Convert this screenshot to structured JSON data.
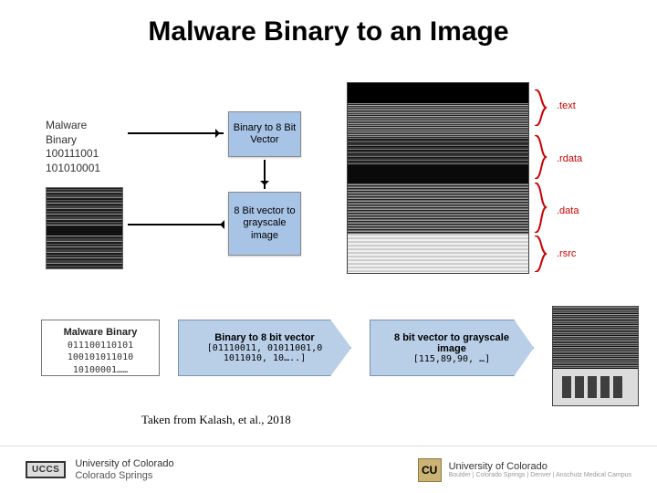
{
  "title": "Malware Binary to an Image",
  "upper": {
    "malware_label_l1": "Malware",
    "malware_label_l2": "Binary",
    "malware_bits_l1": "100111001",
    "malware_bits_l2": "101010001",
    "box_binary": "Binary to 8 Bit Vector",
    "box_vector": "8 Bit vector to grayscale image",
    "sections": {
      "text": ".text",
      "rdata": ".rdata",
      "data": ".data",
      "rsrc": ".rsrc"
    }
  },
  "lower": {
    "box1_hdr": "Malware Binary",
    "box1_l1": "011100110101",
    "box1_l2": "100101011010",
    "box1_l3": "10100001……",
    "arrow1_hdr": "Binary to 8 bit vector",
    "arrow1_sub": "[01110011, 01011001,0 1011010, 10…..]",
    "arrow2_hdr": "8 bit vector to grayscale image",
    "arrow2_sub": "[115,89,90, …]"
  },
  "citation": "Taken from Kalash, et al., 2018",
  "footer": {
    "uccs_badge": "UCCS",
    "uccs_l1": "University of Colorado",
    "uccs_l2": "Colorado Springs",
    "cu_badge": "CU",
    "cu_l1": "University of Colorado",
    "cu_l2": "Boulder | Colorado Springs | Denver | Anschutz Medical Campus"
  }
}
